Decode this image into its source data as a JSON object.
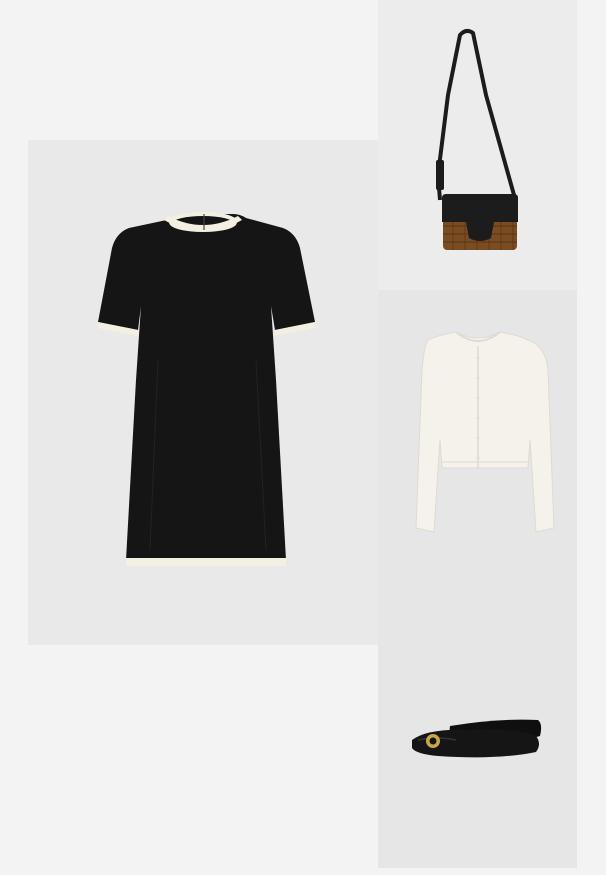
{
  "products": [
    {
      "id": "dress",
      "icon": "dress-icon",
      "colors": {
        "body": "#151515",
        "trim": "#f3f0e2"
      }
    },
    {
      "id": "bag",
      "icon": "crossbody-bag-icon",
      "colors": {
        "leather": "#1c1c1c",
        "rattan": "#7a4c22"
      }
    },
    {
      "id": "cardigan",
      "icon": "cardigan-icon",
      "colors": {
        "knit": "#f4f2ea"
      }
    },
    {
      "id": "flats",
      "icon": "ballet-flats-icon",
      "colors": {
        "leather": "#151515",
        "logo": "#c9a64a"
      }
    }
  ]
}
